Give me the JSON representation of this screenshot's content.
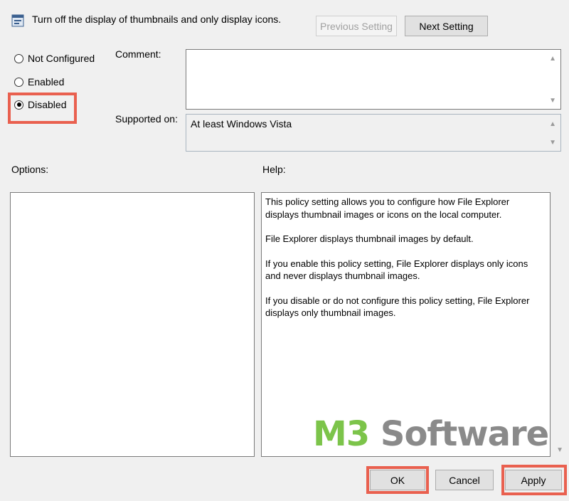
{
  "header": {
    "title": "Turn off the display of thumbnails and only display icons.",
    "prev_label": "Previous Setting",
    "next_label": "Next Setting"
  },
  "state": {
    "options": [
      {
        "label": "Not Configured",
        "checked": false
      },
      {
        "label": "Enabled",
        "checked": false
      },
      {
        "label": "Disabled",
        "checked": true
      }
    ]
  },
  "comment": {
    "label": "Comment:",
    "value": ""
  },
  "supported": {
    "label": "Supported on:",
    "value": "At least Windows Vista"
  },
  "options_pane": {
    "label": "Options:"
  },
  "help": {
    "label": "Help:",
    "paragraphs": [
      "This policy setting allows you to configure how File Explorer displays thumbnail images or icons on the local computer.",
      "File Explorer displays thumbnail images by default.",
      "If you enable this policy setting, File Explorer displays only icons and never displays thumbnail images.",
      "If you disable or do not configure this policy setting, File Explorer displays only thumbnail images."
    ]
  },
  "footer": {
    "ok_label": "OK",
    "cancel_label": "Cancel",
    "apply_label": "Apply"
  },
  "watermark": {
    "part1": "M3",
    "part2": " Software"
  },
  "colors": {
    "highlight": "#e9604f",
    "watermark_green": "#7cc44a",
    "watermark_gray": "#8a8a8a"
  }
}
